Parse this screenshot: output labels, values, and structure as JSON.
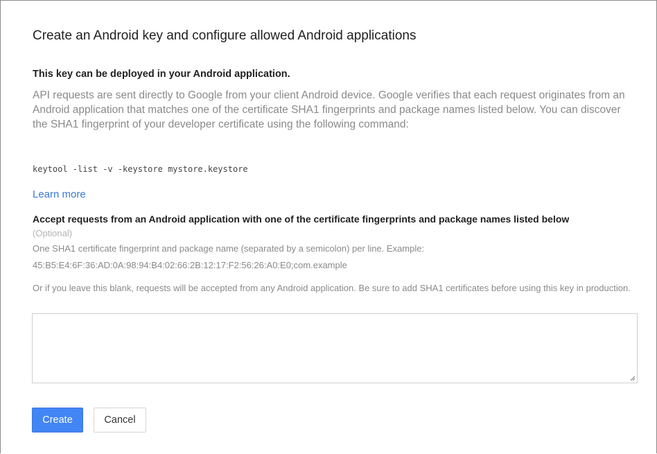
{
  "dialog": {
    "title": "Create an Android key and configure allowed Android applications",
    "deploy_heading": "This key can be deployed in your Android application.",
    "description": "API requests are sent directly to Google from your client Android device. Google verifies that each request originates from an Android application that matches one of the certificate SHA1 fingerprints and package names listed below. You can discover the SHA1 fingerprint of your developer certificate using the following command:",
    "command": "keytool -list -v -keystore mystore.keystore",
    "learn_more_label": "Learn more",
    "accept_heading": "Accept requests from an Android application with one of the certificate fingerprints and package names listed below",
    "optional_label": "(Optional)",
    "instruction_line1": "One SHA1 certificate fingerprint and package name (separated by a semicolon) per line. Example:",
    "instruction_line2": "45:B5:E4:6F:36:AD:0A:98:94:B4:02:66:2B:12:17:F2:56:26:A0:E0;com.example",
    "blank_note": "Or if you leave this blank, requests will be accepted from any Android application. Be sure to add SHA1 certificates before using this key in production.",
    "fingerprints_value": "",
    "create_label": "Create",
    "cancel_label": "Cancel"
  },
  "colors": {
    "primary": "#4285f4",
    "link": "#3a78d8",
    "muted_text": "#8a8a8a"
  }
}
